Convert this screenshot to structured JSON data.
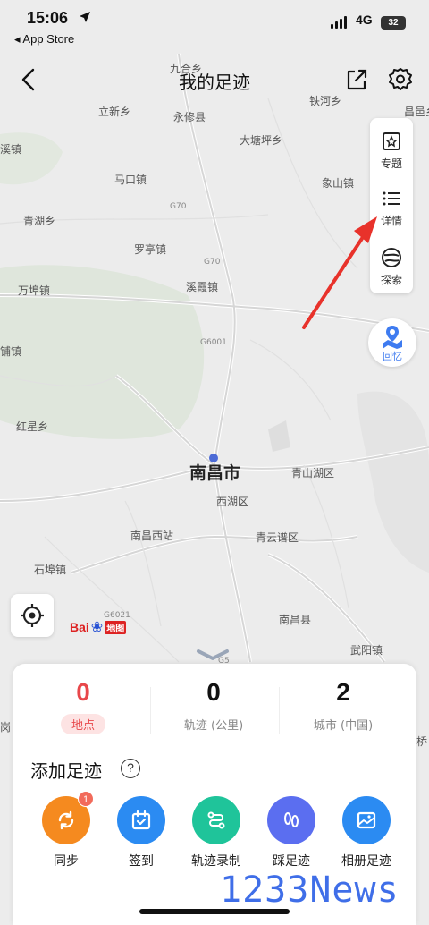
{
  "status_bar": {
    "time": "15:06",
    "back_app": "◂ App Store",
    "network": "4G",
    "battery": "32"
  },
  "nav": {
    "title": "我的足迹"
  },
  "map": {
    "places": [
      {
        "name": "九合乡",
        "kind": "town"
      },
      {
        "name": "立新乡",
        "kind": "town"
      },
      {
        "name": "永修县",
        "kind": "county"
      },
      {
        "name": "铁河乡",
        "kind": "town"
      },
      {
        "name": "昌邑乡",
        "kind": "town"
      },
      {
        "name": "溪镇",
        "kind": "town"
      },
      {
        "name": "大塘坪乡",
        "kind": "town"
      },
      {
        "name": "马口镇",
        "kind": "town"
      },
      {
        "name": "象山镇",
        "kind": "town"
      },
      {
        "name": "青湖乡",
        "kind": "town"
      },
      {
        "name": "罗亭镇",
        "kind": "town"
      },
      {
        "name": "万埠镇",
        "kind": "town"
      },
      {
        "name": "溪霞镇",
        "kind": "town"
      },
      {
        "name": "铺镇",
        "kind": "town"
      },
      {
        "name": "红星乡",
        "kind": "town"
      },
      {
        "name": "南昌市",
        "kind": "city"
      },
      {
        "name": "青山湖区",
        "kind": "district"
      },
      {
        "name": "西湖区",
        "kind": "district"
      },
      {
        "name": "南昌西站",
        "kind": "station"
      },
      {
        "name": "青云谱区",
        "kind": "district"
      },
      {
        "name": "石埠镇",
        "kind": "town"
      },
      {
        "name": "南昌县",
        "kind": "county"
      },
      {
        "name": "武阳镇",
        "kind": "town"
      },
      {
        "name": "岗",
        "kind": "town"
      },
      {
        "name": "桥",
        "kind": "town"
      }
    ],
    "road_tags": [
      "G70",
      "G70",
      "G6001",
      "G6021",
      "G5"
    ],
    "brand": {
      "name": "Bai",
      "suffix": "地图"
    }
  },
  "side_panel": {
    "items": [
      {
        "label": "专题",
        "icon": "topic-icon"
      },
      {
        "label": "详情",
        "icon": "list-icon"
      },
      {
        "label": "探索",
        "icon": "explore-icon"
      }
    ],
    "memory": {
      "label": "回忆",
      "icon": "memory-map-icon"
    }
  },
  "stats": [
    {
      "value": "0",
      "label": "地点",
      "active": true
    },
    {
      "value": "0",
      "label": "轨迹 (公里)",
      "active": false
    },
    {
      "value": "2",
      "label": "城市 (中国)",
      "active": false
    }
  ],
  "add_section": {
    "title": "添加足迹",
    "help": "?"
  },
  "actions": [
    {
      "label": "同步",
      "icon": "sync-icon",
      "color": "#f58a1f",
      "badge": "1"
    },
    {
      "label": "签到",
      "icon": "checkin-icon",
      "color": "#2b8bf2",
      "badge": ""
    },
    {
      "label": "轨迹录制",
      "icon": "track-record-icon",
      "color": "#1fc49a",
      "badge": ""
    },
    {
      "label": "踩足迹",
      "icon": "footprint-icon",
      "color": "#5b6ef0",
      "badge": ""
    },
    {
      "label": "相册足迹",
      "icon": "album-icon",
      "color": "#2b8bf2",
      "badge": ""
    }
  ],
  "watermark": "1233News",
  "colors": {
    "accent_red": "#e8474a",
    "annotation_arrow": "#e8322b",
    "memory_blue": "#3e7bf0"
  }
}
